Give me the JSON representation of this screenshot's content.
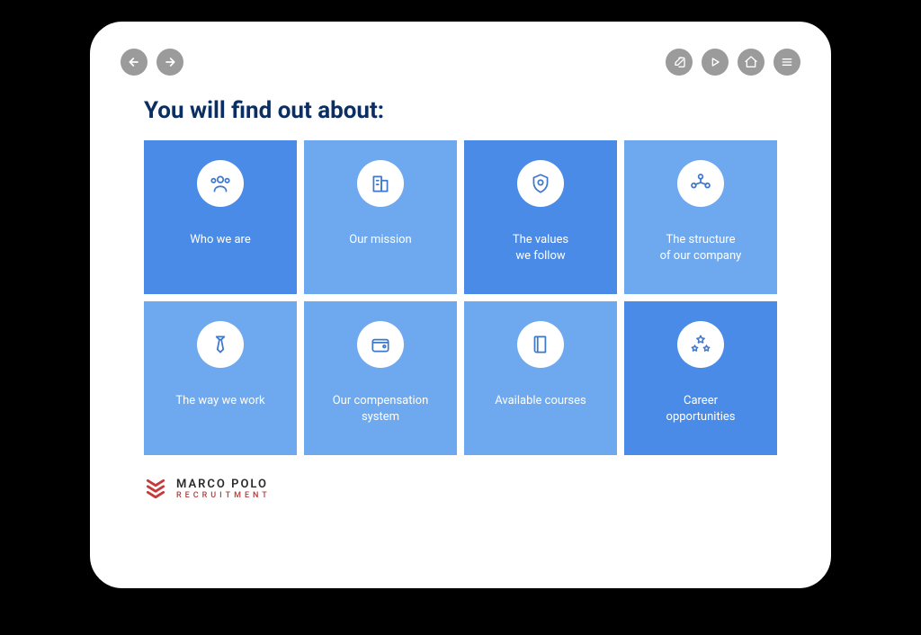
{
  "title": "You will find out about:",
  "cards": [
    {
      "label": "Who we are",
      "variant": "dark",
      "icon": "people"
    },
    {
      "label": "Our mission",
      "variant": "light",
      "icon": "building"
    },
    {
      "label": "The values\nwe follow",
      "variant": "dark",
      "icon": "shield"
    },
    {
      "label": "The structure\nof our company",
      "variant": "light",
      "icon": "share"
    },
    {
      "label": "The way we work",
      "variant": "light",
      "icon": "tie"
    },
    {
      "label": "Our compensation\nsystem",
      "variant": "light",
      "icon": "wallet"
    },
    {
      "label": "Available courses",
      "variant": "light",
      "icon": "book"
    },
    {
      "label": "Career\nopportunities",
      "variant": "dark",
      "icon": "stars"
    }
  ],
  "brand": {
    "name": "MARCO POLO",
    "tagline": "RECRUITMENT"
  },
  "colors": {
    "title": "#0b2e63",
    "card_light": "#6ea8ee",
    "card_dark": "#4a8be8",
    "icon_stroke": "#3f77c9",
    "logo_red": "#c63a3a"
  }
}
